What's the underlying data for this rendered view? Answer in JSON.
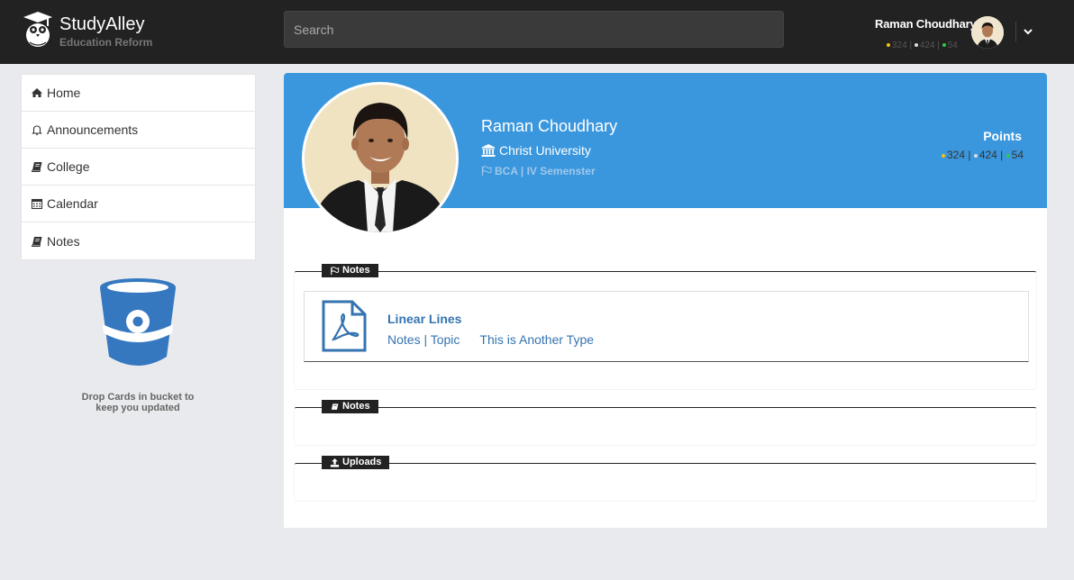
{
  "header": {
    "brand_title": "StudyAlley",
    "brand_subtitle": "Education Reform",
    "search_placeholder": "Search",
    "user_name": "Raman Choudhary",
    "points": [
      "324",
      "424",
      "54"
    ]
  },
  "sidebar": {
    "items": [
      {
        "label": "Home",
        "icon": "home-icon"
      },
      {
        "label": "Announcements",
        "icon": "bell-icon"
      },
      {
        "label": "College",
        "icon": "book-icon"
      },
      {
        "label": "Calendar",
        "icon": "calendar-icon"
      },
      {
        "label": "Notes",
        "icon": "book-icon"
      }
    ],
    "bucket_text": "Drop Cards in bucket to keep you updated"
  },
  "profile": {
    "name": "Raman Choudhary",
    "university": "Christ University",
    "course": "BCA | IV Semenster",
    "points_label": "Points",
    "points": [
      "324",
      "424",
      "54"
    ]
  },
  "sections": [
    {
      "label": "Notes",
      "icon": "flag-icon",
      "cards": [
        {
          "title": "Linear Lines",
          "category": "Notes | Topic",
          "type": "This is Another Type",
          "icon": "pdf-icon"
        }
      ]
    },
    {
      "label": "Notes",
      "icon": "book-icon"
    },
    {
      "label": "Uploads",
      "icon": "upload-icon"
    }
  ],
  "colors": {
    "topbar": "#222222",
    "hero": "#3b97dd",
    "link": "#3574b0",
    "dot_gold": "#f1c40f",
    "dot_silver": "#dddddd",
    "dot_green": "#2ecc40"
  }
}
